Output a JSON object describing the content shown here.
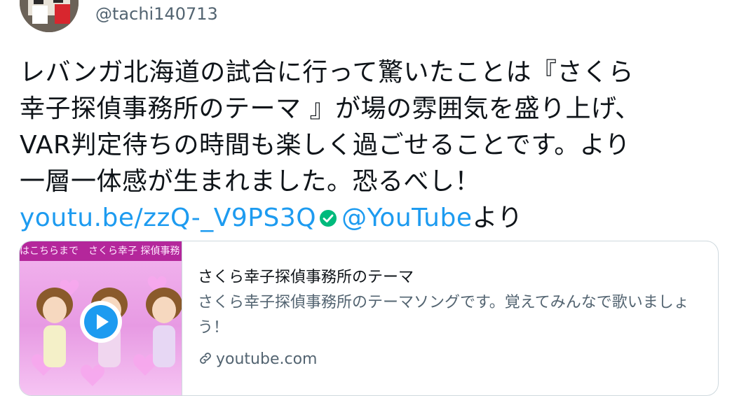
{
  "user": {
    "handle": "@tachi140713",
    "avatar_icon": "profile-photo-icon"
  },
  "tweet": {
    "lines": [
      "レバンガ北海道の試合に行って驚いたことは『さくら",
      "幸子探偵事務所のテーマ 』が場の雰囲気を盛り上げ、",
      "VAR判定待ちの時間も楽しく過ごせることです。より",
      "一層一体感が生まれました。恐るべし！"
    ],
    "link_text": "youtu.be/zzQ-_V9PS3Q",
    "mention": "@YouTube",
    "suffix": "より"
  },
  "card": {
    "thumbnail_banner": "はこちらまで　さくら幸子 探偵事務",
    "title": "さくら幸子探偵事務所のテーマ",
    "description": "さくら幸子探偵事務所のテーマソングです。覚えてみんなで歌いましょう！",
    "domain": "youtube.com"
  },
  "colors": {
    "link": "#1d9bf0",
    "secondary_text": "#536471",
    "verified": "#00ba7c"
  }
}
